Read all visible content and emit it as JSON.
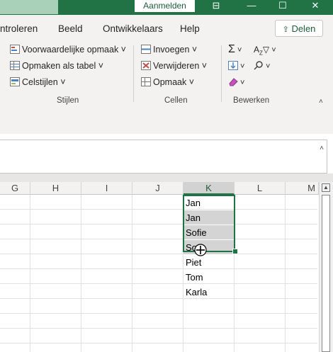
{
  "titlebar": {
    "signin_label": "Aanmelden",
    "minimize_glyph": "—",
    "maximize_glyph": "☐",
    "close_glyph": "✕"
  },
  "menubar": {
    "items": [
      "ntroleren",
      "Beeld",
      "Ontwikkelaars",
      "Help"
    ],
    "share_label": "Delen"
  },
  "ribbon": {
    "styles": {
      "conditional": "Voorwaardelijke opmaak",
      "as_table": "Opmaken als tabel",
      "cell_styles": "Celstijlen",
      "group_label": "Stijlen"
    },
    "cells": {
      "insert": "Invoegen",
      "delete": "Verwijderen",
      "format": "Opmaak",
      "group_label": "Cellen"
    },
    "edit": {
      "group_label": "Bewerken"
    }
  },
  "grid": {
    "columns": [
      "G",
      "H",
      "I",
      "J",
      "K",
      "L",
      "M"
    ],
    "selected_column": "K",
    "cells_k": [
      "Jan",
      "Jan",
      "Sofie",
      "So",
      "Piet",
      "Tom",
      "Karla"
    ]
  },
  "colors": {
    "accent": "#217346",
    "selection": "#d4d4d4"
  }
}
